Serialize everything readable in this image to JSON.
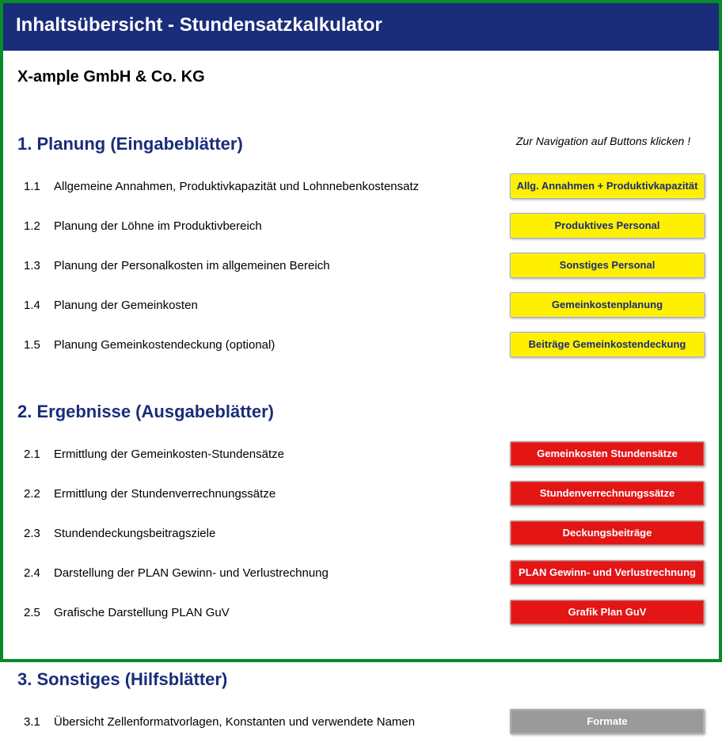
{
  "title": "Inhaltsübersicht - Stundensatzkalkulator",
  "company": "X-ample GmbH & Co. KG",
  "nav_hint": "Zur Navigation auf Buttons klicken !",
  "sections": {
    "s1": {
      "heading": "1. Planung (Eingabeblätter)",
      "rows": [
        {
          "num": "1.1",
          "desc": "Allgemeine Annahmen, Produktivkapazität und Lohnnebenkostensatz",
          "btn": "Allg. Annahmen + Produktivkapazität"
        },
        {
          "num": "1.2",
          "desc": "Planung der Löhne im Produktivbereich",
          "btn": "Produktives Personal"
        },
        {
          "num": "1.3",
          "desc": "Planung der Personalkosten im allgemeinen Bereich",
          "btn": "Sonstiges Personal"
        },
        {
          "num": "1.4",
          "desc": "Planung der Gemeinkosten",
          "btn": "Gemeinkostenplanung"
        },
        {
          "num": "1.5",
          "desc": "Planung Gemeinkostendeckung (optional)",
          "btn": "Beiträge Gemeinkostendeckung"
        }
      ]
    },
    "s2": {
      "heading": "2. Ergebnisse (Ausgabeblätter)",
      "rows": [
        {
          "num": "2.1",
          "desc": "Ermittlung der Gemeinkosten-Stundensätze",
          "btn": "Gemeinkosten Stundensätze"
        },
        {
          "num": "2.2",
          "desc": "Ermittlung der Stundenverrechnungssätze",
          "btn": "Stundenverrechnungssätze"
        },
        {
          "num": "2.3",
          "desc": "Stundendeckungsbeitragsziele",
          "btn": "Deckungsbeiträge"
        },
        {
          "num": "2.4",
          "desc": "Darstellung der PLAN Gewinn- und Verlustrechnung",
          "btn": "PLAN Gewinn- und Verlustrechnung"
        },
        {
          "num": "2.5",
          "desc": "Grafische Darstellung PLAN GuV",
          "btn": "Grafik Plan GuV"
        }
      ]
    },
    "s3": {
      "heading": "3. Sonstiges (Hilfsblätter)",
      "rows": [
        {
          "num": "3.1",
          "desc": "Übersicht Zellenformatvorlagen, Konstanten und verwendete Namen",
          "btn": "Formate"
        }
      ]
    }
  }
}
